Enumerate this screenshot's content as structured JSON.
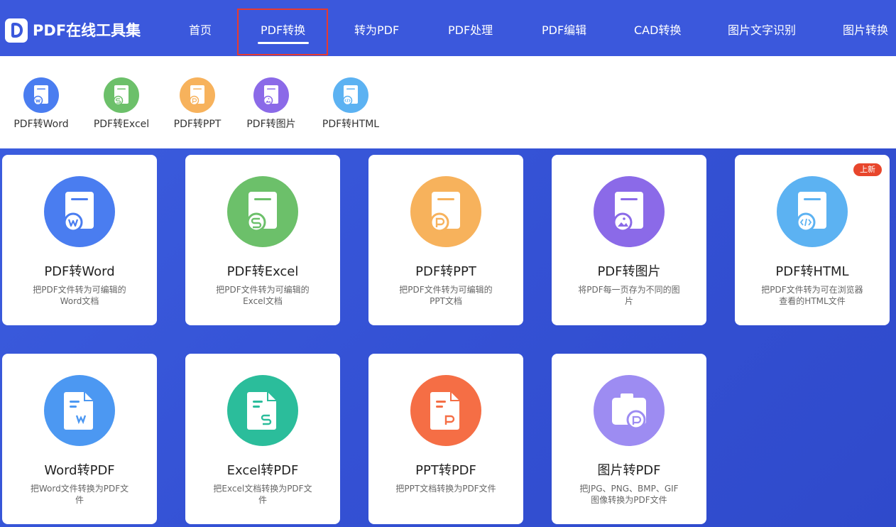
{
  "app": {
    "title": "PDF在线工具集"
  },
  "nav": {
    "items": [
      {
        "label": "首页"
      },
      {
        "label": "PDF转换"
      },
      {
        "label": "转为PDF"
      },
      {
        "label": "PDF处理"
      },
      {
        "label": "PDF编辑"
      },
      {
        "label": "CAD转换"
      },
      {
        "label": "图片文字识别"
      },
      {
        "label": "图片转换"
      }
    ],
    "active": "PDF转换"
  },
  "submenu": {
    "items": [
      {
        "label": "PDF转Word",
        "color": "#4a7df0",
        "icon": "word-doc-icon"
      },
      {
        "label": "PDF转Excel",
        "color": "#6cc06a",
        "icon": "excel-doc-icon"
      },
      {
        "label": "PDF转PPT",
        "color": "#f7b25c",
        "icon": "ppt-doc-icon"
      },
      {
        "label": "PDF转图片",
        "color": "#8b6ae8",
        "icon": "image-doc-icon"
      },
      {
        "label": "PDF转HTML",
        "color": "#5cb2f2",
        "icon": "html-doc-icon"
      }
    ]
  },
  "cards": [
    {
      "title": "PDF转Word",
      "desc": "把PDF文件转为可编辑的Word文档",
      "color": "#4a7df0",
      "icon": "word-doc-icon"
    },
    {
      "title": "PDF转Excel",
      "desc": "把PDF文件转为可编辑的Excel文档",
      "color": "#6cc06a",
      "icon": "excel-doc-icon"
    },
    {
      "title": "PDF转PPT",
      "desc": "把PDF文件转为可编辑的PPT文档",
      "color": "#f7b25c",
      "icon": "ppt-doc-icon"
    },
    {
      "title": "PDF转图片",
      "desc": "将PDF每一页存为不同的图片",
      "color": "#8b6ae8",
      "icon": "image-doc-icon"
    },
    {
      "title": "PDF转HTML",
      "desc": "把PDF文件转为可在浏览器查看的HTML文件",
      "color": "#5cb2f2",
      "icon": "html-doc-icon",
      "badge": "上新"
    },
    {
      "title": "Word转PDF",
      "desc": "把Word文件转换为PDF文件",
      "color": "#4c98f2",
      "icon": "word-to-pdf-icon"
    },
    {
      "title": "Excel转PDF",
      "desc": "把Excel文档转换为PDF文件",
      "color": "#2bbd9b",
      "icon": "excel-to-pdf-icon"
    },
    {
      "title": "PPT转PDF",
      "desc": "把PPT文档转换为PDF文件",
      "color": "#f56e45",
      "icon": "ppt-to-pdf-icon"
    },
    {
      "title": "图片转PDF",
      "desc": "把JPG、PNG、BMP、GIF图像转换为PDF文件",
      "color": "#9d8cf2",
      "icon": "camera-icon"
    }
  ]
}
